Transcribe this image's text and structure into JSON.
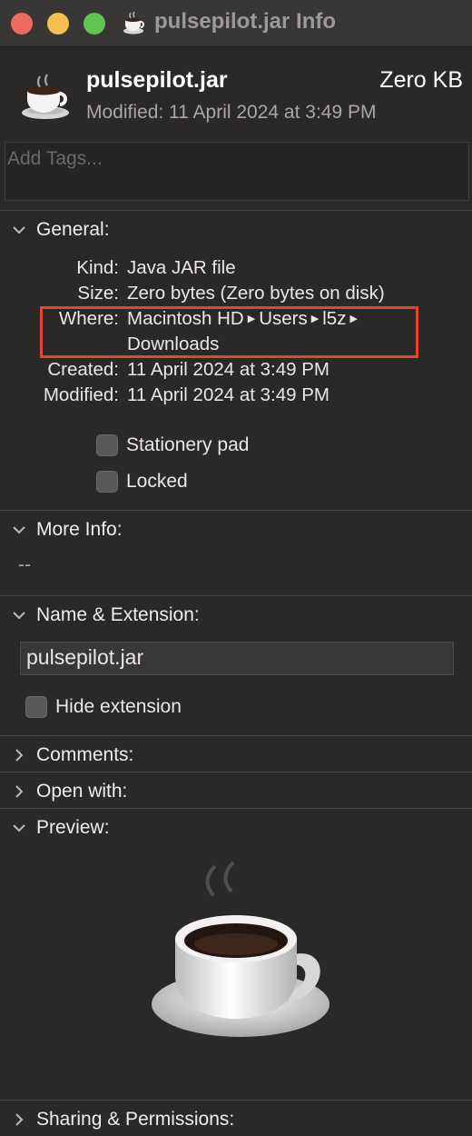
{
  "window": {
    "title": "pulsepilot.jar Info"
  },
  "header": {
    "name": "pulsepilot.jar",
    "size": "Zero KB",
    "modified": "Modified: 11 April 2024 at 3:49 PM"
  },
  "tags": {
    "placeholder": "Add Tags..."
  },
  "general": {
    "label": "General:",
    "kind_label": "Kind:",
    "kind_value": "Java JAR file",
    "size_label": "Size:",
    "size_value": "Zero bytes (Zero bytes on disk)",
    "where_label": "Where:",
    "where_path": [
      "Macintosh HD",
      "Users",
      "l5z",
      "Downloads"
    ],
    "created_label": "Created:",
    "created_value": "11 April 2024 at 3:49 PM",
    "modified_label": "Modified:",
    "modified_value": "11 April 2024 at 3:49 PM",
    "stationery_label": "Stationery pad",
    "locked_label": "Locked"
  },
  "more_info": {
    "label": "More Info:",
    "value": "--"
  },
  "name_extension": {
    "label": "Name & Extension:",
    "value": "pulsepilot.jar",
    "hide_extension_label": "Hide extension"
  },
  "comments": {
    "label": "Comments:"
  },
  "open_with": {
    "label": "Open with:"
  },
  "preview": {
    "label": "Preview:"
  },
  "sharing": {
    "label": "Sharing & Permissions:"
  },
  "colors": {
    "highlight": "#e5452f",
    "background": "#2b2828"
  },
  "icons": {
    "file": "java-coffee-cup-icon"
  }
}
